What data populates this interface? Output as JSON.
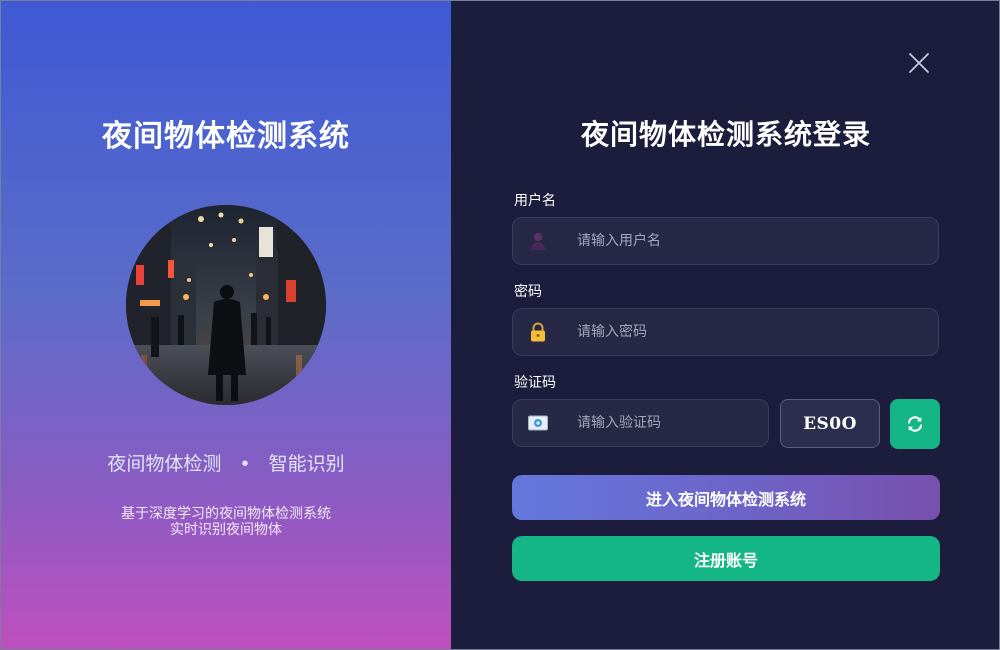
{
  "left": {
    "title": "夜间物体检测系统",
    "tagline_left": "夜间物体检测",
    "tagline_sep": "•",
    "tagline_right": "智能识别",
    "desc_line1": "基于深度学习的夜间物体检测系统",
    "desc_line2": "实时识别夜间物体"
  },
  "login": {
    "title": "夜间物体检测系统登录",
    "username": {
      "label": "用户名",
      "placeholder": "请输入用户名",
      "value": "",
      "icon": "person-icon"
    },
    "password": {
      "label": "密码",
      "placeholder": "请输入密码",
      "value": "",
      "icon": "lock-icon"
    },
    "captcha": {
      "label": "验证码",
      "placeholder": "请输入验证码",
      "value": "",
      "icon": "envelope-icon",
      "code": "ES0O"
    },
    "submit_label": "进入夜间物体检测系统",
    "register_label": "注册账号"
  },
  "colors": {
    "accent_green": "#14b685",
    "panel_dark": "#1c1d3c",
    "gradient_top": "#3f59d4",
    "gradient_bottom": "#c04fbf"
  }
}
